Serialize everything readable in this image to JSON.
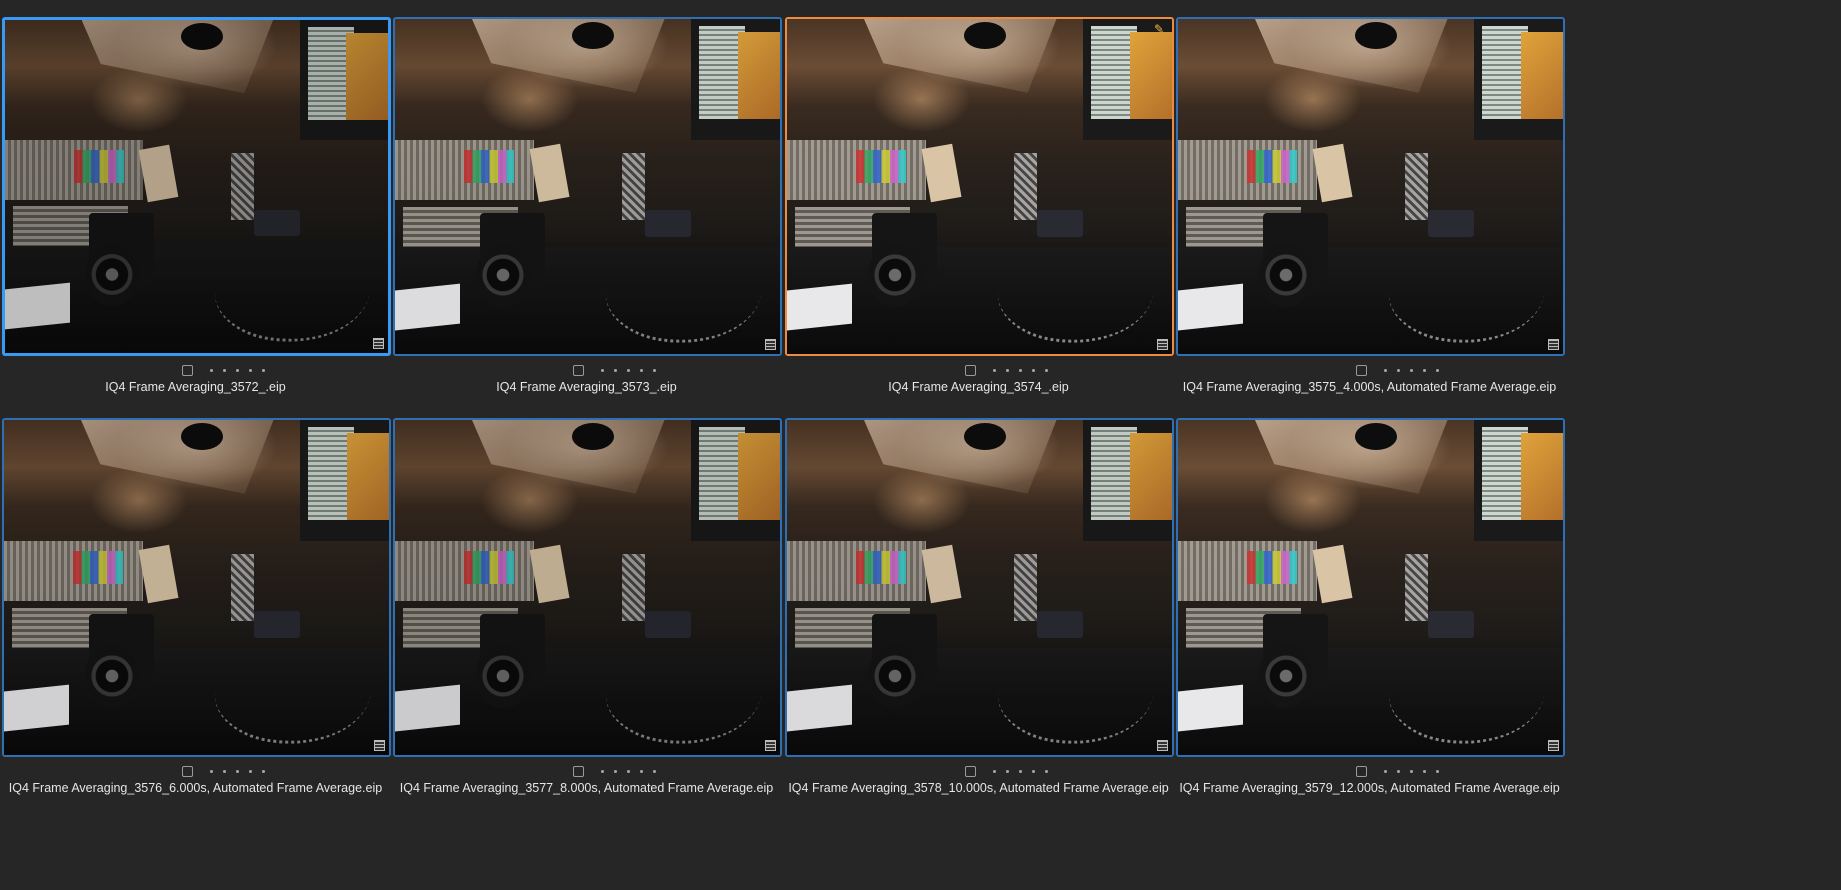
{
  "browser": {
    "thumbnails": [
      {
        "filename": "IQ4 Frame Averaging_3572_.eip",
        "rating": 0,
        "selected": true,
        "active": false,
        "edited": false
      },
      {
        "filename": "IQ4 Frame Averaging_3573_.eip",
        "rating": 0,
        "selected": false,
        "active": false,
        "edited": false
      },
      {
        "filename": "IQ4 Frame Averaging_3574_.eip",
        "rating": 0,
        "selected": false,
        "active": true,
        "edited": true
      },
      {
        "filename": "IQ4 Frame Averaging_3575_4.000s, Automated Frame Average.eip",
        "rating": 0,
        "selected": false,
        "active": false,
        "edited": false
      },
      {
        "filename": "IQ4 Frame Averaging_3576_6.000s, Automated Frame Average.eip",
        "rating": 0,
        "selected": false,
        "active": false,
        "edited": false
      },
      {
        "filename": "IQ4 Frame Averaging_3577_8.000s, Automated Frame Average.eip",
        "rating": 0,
        "selected": false,
        "active": false,
        "edited": false
      },
      {
        "filename": "IQ4 Frame Averaging_3578_10.000s, Automated Frame Average.eip",
        "rating": 0,
        "selected": false,
        "active": false,
        "edited": false
      },
      {
        "filename": "IQ4 Frame Averaging_3579_12.000s, Automated Frame Average.eip",
        "rating": 0,
        "selected": false,
        "active": false,
        "edited": false
      }
    ],
    "colors": {
      "background": "#262626",
      "selected_border": "#3a99f2",
      "active_border": "#f08a3c",
      "default_border": "#2f6fb3",
      "caption_text": "#e6e6e6"
    },
    "icons": {
      "variant_badge": "layers-icon",
      "edited_marker": "pencil-icon",
      "checkbox": "checkbox-icon",
      "rating": "rating-dots"
    }
  }
}
